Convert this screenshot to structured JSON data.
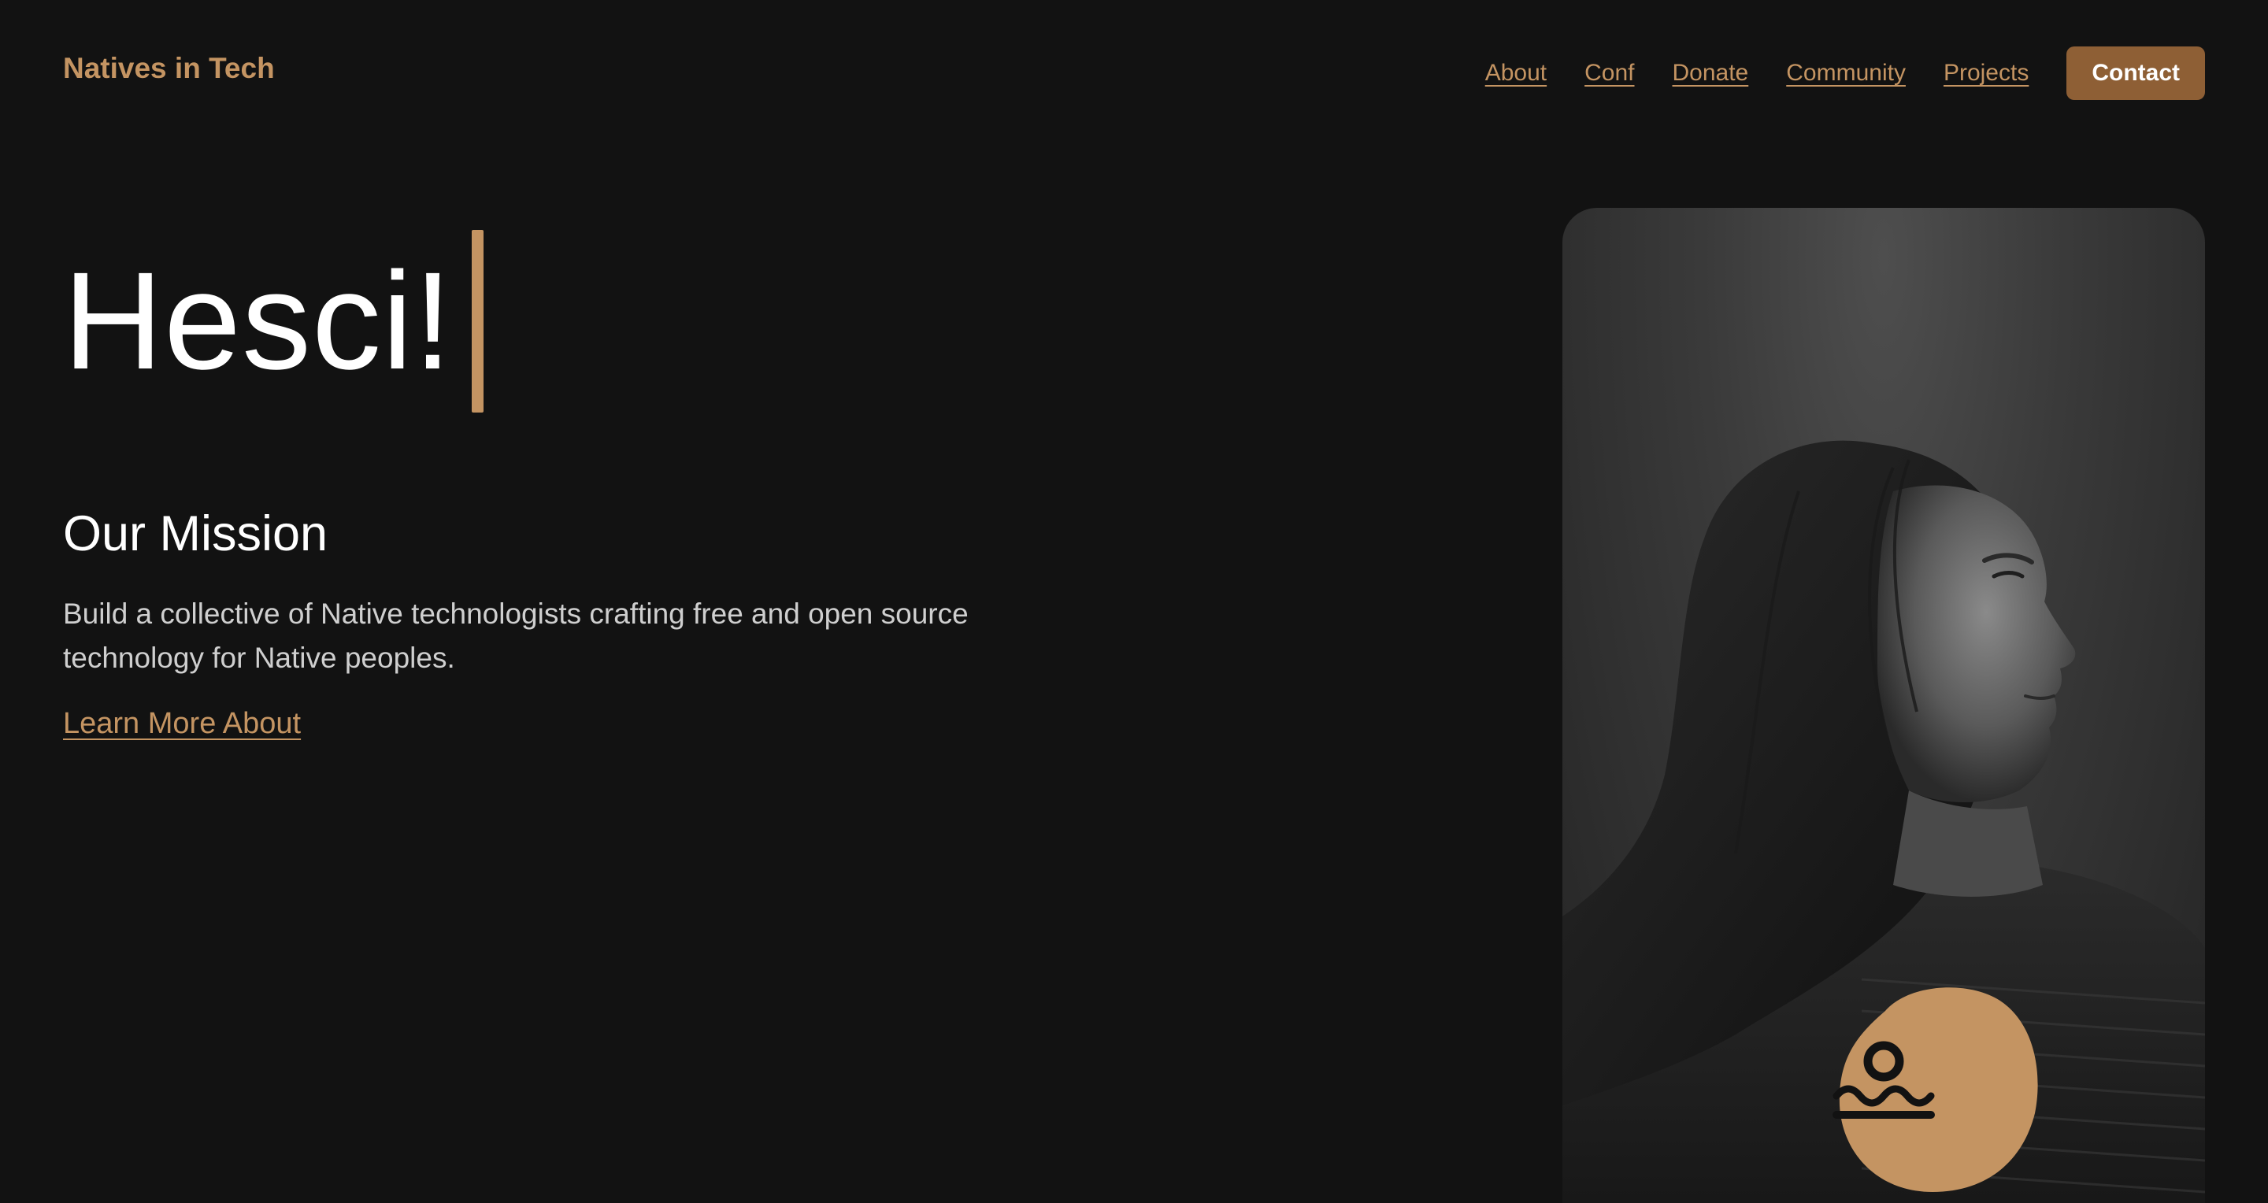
{
  "header": {
    "brand": "Natives in Tech",
    "nav": [
      {
        "label": "About"
      },
      {
        "label": "Conf"
      },
      {
        "label": "Donate"
      },
      {
        "label": "Community"
      },
      {
        "label": "Projects"
      }
    ],
    "contact_label": "Contact"
  },
  "hero": {
    "greeting": "Hesci!",
    "mission_heading": "Our Mission",
    "mission_body": "Build a collective of Native technologists crafting free and open source technology for Native peoples.",
    "learn_more_label": "Learn More About"
  },
  "photo": {
    "badge_icon": "sun-over-water-icon"
  },
  "colors": {
    "background": "#121212",
    "accent": "#c49462",
    "button": "#8e5f35",
    "text": "#ffffff",
    "muted_text": "#cfcfcf"
  }
}
